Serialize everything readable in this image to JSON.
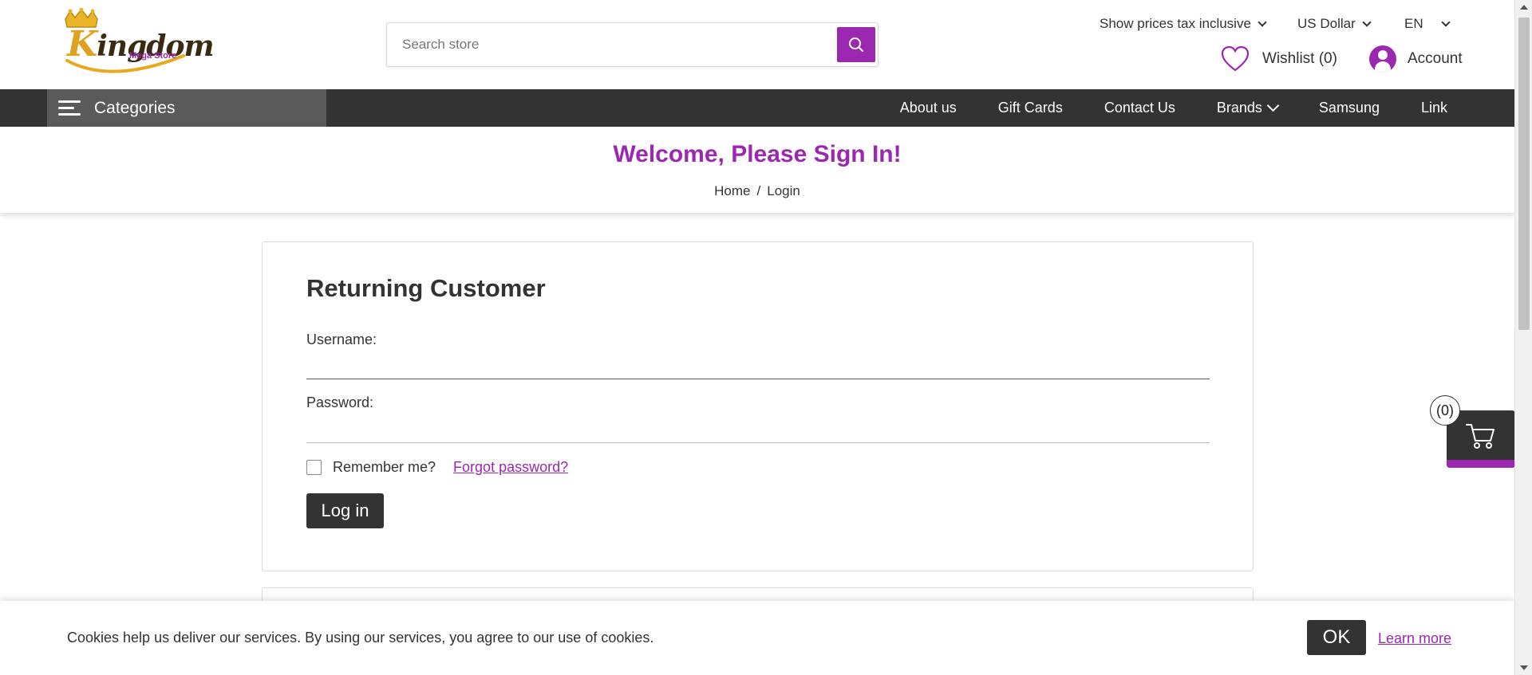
{
  "header": {
    "logo_main": "ingdom",
    "logo_initial": "K",
    "logo_sub": "Mega Store",
    "search": {
      "placeholder": "Search store"
    },
    "tax_toggle": "Show prices tax inclusive",
    "currency": "US Dollar",
    "language": "EN",
    "wishlist": "Wishlist (0)",
    "account": "Account"
  },
  "navbar": {
    "categories": "Categories",
    "links": [
      "About us",
      "Gift Cards",
      "Contact Us",
      "Brands",
      "Samsung",
      "Link"
    ]
  },
  "page": {
    "title": "Welcome, Please Sign In!",
    "breadcrumb": {
      "home": "Home",
      "separator": "/",
      "current": "Login"
    }
  },
  "login": {
    "title": "Returning Customer",
    "username_label": "Username:",
    "username_value": "",
    "password_label": "Password:",
    "password_value": "",
    "remember_label": "Remember me?",
    "remember_checked": false,
    "forgot_label": "Forgot password?",
    "submit_label": "Log in"
  },
  "cart": {
    "count": "(0)"
  },
  "cookie": {
    "message": "Cookies help us deliver our services. By using our services, you agree to our use of cookies.",
    "ok_label": "OK",
    "learn_more": "Learn more"
  },
  "colors": {
    "accent": "#9c27b0",
    "dark": "#333333",
    "nav_category_bg": "#5a5a5a"
  },
  "icons": {
    "search": "search-icon",
    "wishlist": "heart-icon",
    "account": "user-icon",
    "categories": "hamburger-icon",
    "cart": "cart-icon"
  }
}
